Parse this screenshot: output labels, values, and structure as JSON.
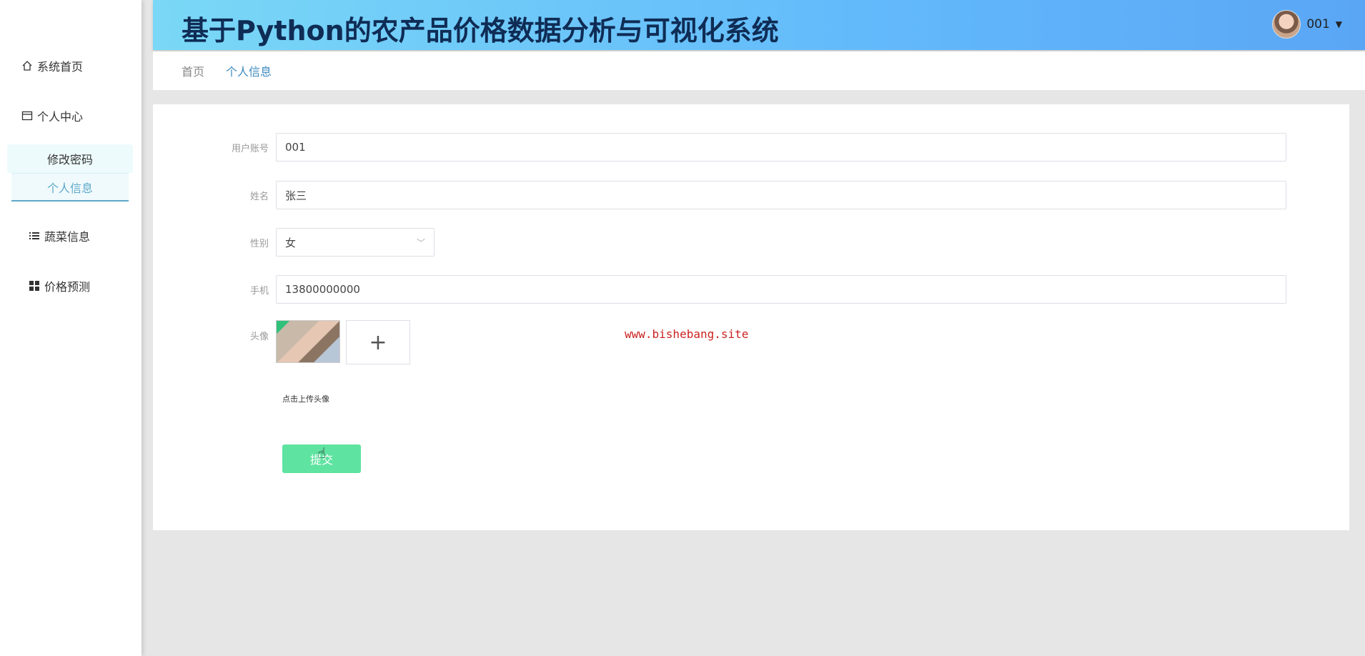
{
  "sidebar": {
    "items": [
      {
        "label": "系统首页",
        "icon": "home-icon"
      },
      {
        "label": "个人中心",
        "icon": "card-icon"
      },
      {
        "label": "蔬菜信息",
        "icon": "list-icon"
      },
      {
        "label": "价格预测",
        "icon": "grid-icon"
      }
    ],
    "submenu": [
      {
        "label": "修改密码"
      },
      {
        "label": "个人信息"
      }
    ]
  },
  "header": {
    "title": "基于Python的农产品价格数据分析与可视化系统",
    "username": "001"
  },
  "breadcrumb": {
    "home": "首页",
    "current": "个人信息"
  },
  "form": {
    "account_label": "用户账号",
    "account_value": "001",
    "name_label": "姓名",
    "name_value": "张三",
    "gender_label": "性别",
    "gender_value": "女",
    "phone_label": "手机",
    "phone_value": "13800000000",
    "avatar_label": "头像",
    "upload_hint": "点击上传头像",
    "submit_label": "提交"
  },
  "watermark": "www.bishebang.site"
}
